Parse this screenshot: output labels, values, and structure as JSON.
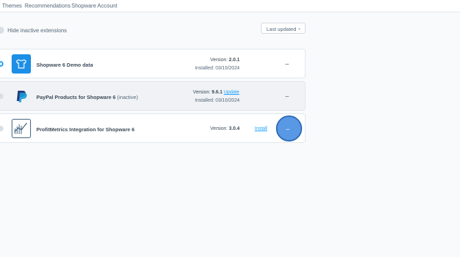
{
  "top_nav": {
    "tabs": [
      {
        "label": "Themes"
      },
      {
        "label": "Recommendations"
      },
      {
        "label": "Shopware Account"
      }
    ]
  },
  "toolbar": {
    "hide_inactive_label": "Hide inactive extensions",
    "sort_value": "Last updated"
  },
  "extensions": [
    {
      "name": "Shopware 6 Demo data",
      "status_suffix": "",
      "version_label": "Version:",
      "version": "2.0.1",
      "installed_label": "Installed:",
      "installed_date": "03/10/2024",
      "action_link": "",
      "active": true,
      "icon": "tshirt-icon"
    },
    {
      "name": "PayPal Products for Shopware 6",
      "status_suffix": "(inactive)",
      "version_label": "Version:",
      "version": "9.6.1",
      "installed_label": "Installed:",
      "installed_date": "03/10/2024",
      "action_link": "Update",
      "active": false,
      "icon": "paypal-icon"
    },
    {
      "name": "ProfitMetrics Integration for Shopware 6",
      "status_suffix": "",
      "version_label": "Version:",
      "version": "3.0.4",
      "installed_label": "",
      "installed_date": "",
      "action_link": "Install",
      "active": false,
      "icon": "chart-icon"
    }
  ],
  "more_label": "...",
  "colors": {
    "accent": "#189eff",
    "click_highlight": "#4a90e2"
  }
}
